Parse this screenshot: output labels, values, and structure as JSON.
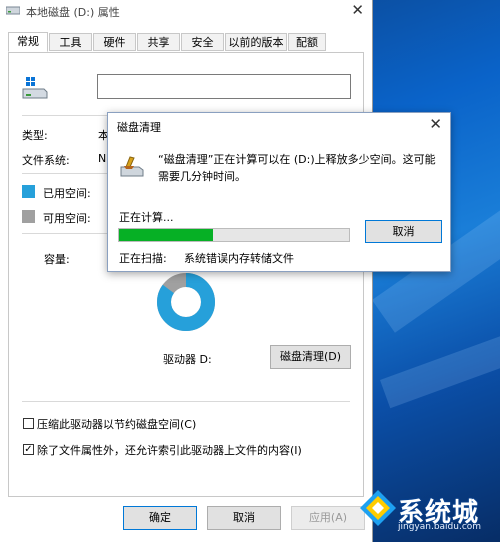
{
  "window": {
    "title": "本地磁盘 (D:) 属性",
    "close_glyph": "✕"
  },
  "tabs": [
    {
      "label": "常规",
      "active": true
    },
    {
      "label": "工具"
    },
    {
      "label": "硬件"
    },
    {
      "label": "共享"
    },
    {
      "label": "安全"
    },
    {
      "label": "以前的版本"
    },
    {
      "label": "配额"
    }
  ],
  "general": {
    "name_value": "",
    "type_label": "类型:",
    "type_value": "本",
    "fs_label": "文件系统:",
    "fs_value": "N",
    "used_label": "已用空间:",
    "free_label": "可用空间:",
    "capacity_label": "容量:",
    "drive_label": "驱动器 D:",
    "cleanup_button": "磁盘清理(D)",
    "compress_label": "压缩此驱动器以节约磁盘空间(C)",
    "compress_checked": false,
    "index_label": "除了文件属性外，还允许索引此驱动器上文件的内容(I)",
    "index_checked": true,
    "used_fraction": 0.85
  },
  "colors": {
    "used": "#26a0da",
    "free": "#a0a0a0",
    "progress": "#06b025",
    "accent": "#0078d7"
  },
  "footer": {
    "ok": "确定",
    "cancel": "取消",
    "apply": "应用(A)"
  },
  "cleanup_dialog": {
    "title": "磁盘清理",
    "message": "“磁盘清理”正在计算可以在 (D:)上释放多少空间。这可能需要几分钟时间。",
    "status": "正在计算...",
    "progress": 0.41,
    "cancel": "取消",
    "scanning_label": "正在扫描:",
    "scanning_item": "系统错误内存转储文件"
  },
  "watermark": {
    "text": "系统城",
    "url": "jingyan.baidu.com"
  }
}
